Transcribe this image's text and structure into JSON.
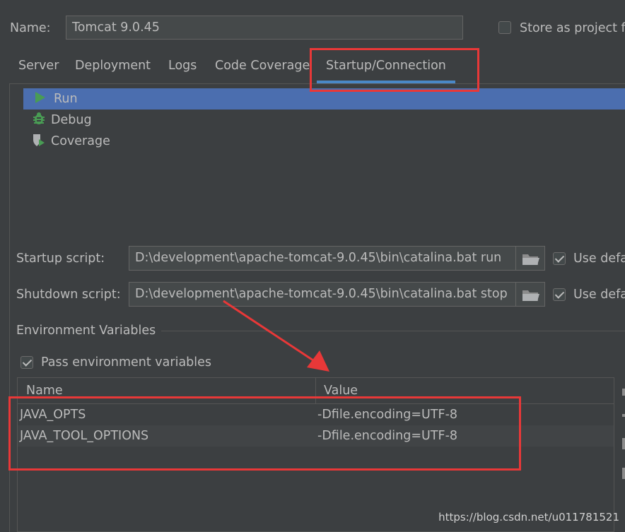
{
  "header": {
    "name_label": "Name:",
    "name_value": "Tomcat 9.0.45",
    "store_label": "Store as project fi"
  },
  "tabs": [
    {
      "label": "Server"
    },
    {
      "label": "Deployment"
    },
    {
      "label": "Logs"
    },
    {
      "label": "Code Coverage"
    },
    {
      "label": "Startup/Connection",
      "selected": true
    }
  ],
  "modes": [
    {
      "label": "Run",
      "icon": "run-icon",
      "selected": true
    },
    {
      "label": "Debug",
      "icon": "debug-icon"
    },
    {
      "label": "Coverage",
      "icon": "coverage-icon"
    }
  ],
  "startup": {
    "label": "Startup script:",
    "value": "D:\\development\\apache-tomcat-9.0.45\\bin\\catalina.bat run",
    "use_default": "Use defa"
  },
  "shutdown": {
    "label": "Shutdown script:",
    "value": "D:\\development\\apache-tomcat-9.0.45\\bin\\catalina.bat stop",
    "use_default": "Use defa"
  },
  "env": {
    "section_title": "Environment Variables",
    "pass_label": "Pass environment variables",
    "pass_checked": true,
    "columns": {
      "name": "Name",
      "value": "Value"
    },
    "rows": [
      {
        "name": "JAVA_OPTS",
        "value": "-Dfile.encoding=UTF-8"
      },
      {
        "name": "JAVA_TOOL_OPTIONS",
        "value": "-Dfile.encoding=UTF-8"
      }
    ]
  },
  "watermark": "https://blog.csdn.net/u011781521",
  "colors": {
    "background": "#3c3f41",
    "selection": "#4b6eaf",
    "tab_underline": "#4a88c7",
    "annotation_red": "#e83838",
    "run_green": "#499c54"
  }
}
